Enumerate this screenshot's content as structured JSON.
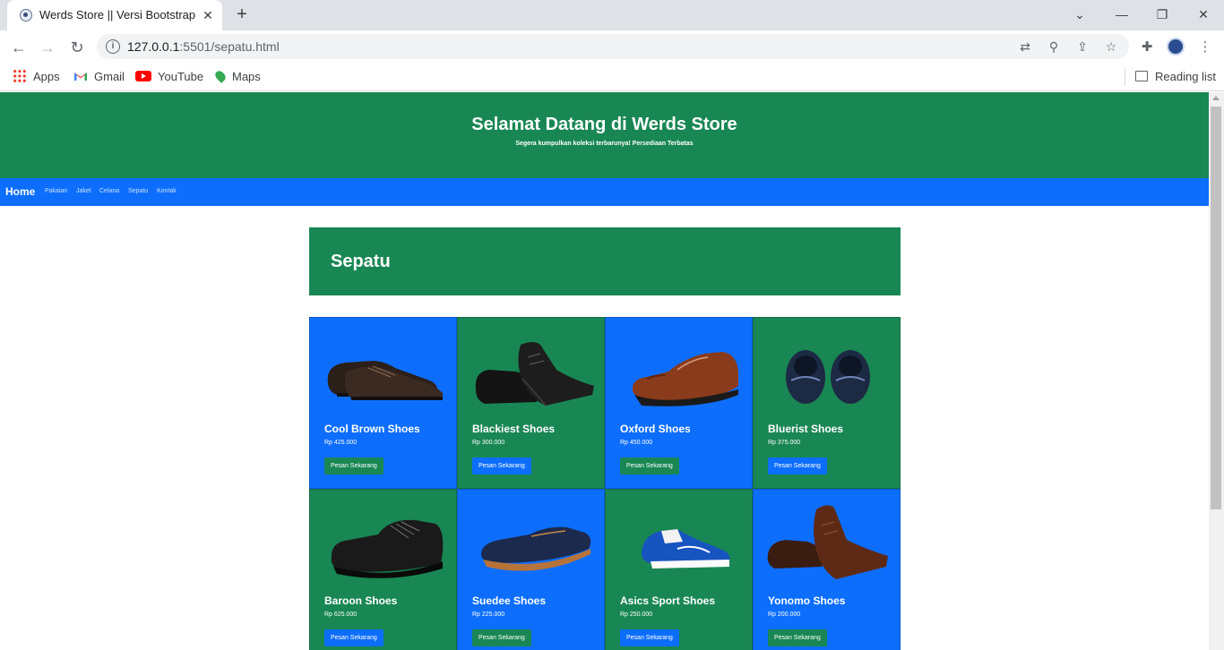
{
  "browser": {
    "tab_title": "Werds Store || Versi Bootstrap",
    "url_host": "127.0.0.1",
    "url_rest": ":5501/sepatu.html",
    "bookmarks": [
      {
        "label": "Apps",
        "icon": "apps-grid-icon"
      },
      {
        "label": "Gmail",
        "icon": "gmail-icon"
      },
      {
        "label": "YouTube",
        "icon": "youtube-icon"
      },
      {
        "label": "Maps",
        "icon": "maps-icon"
      }
    ],
    "reading_list": "Reading list"
  },
  "hero": {
    "title": "Selamat Datang di Werds Store",
    "subtitle": "Segera kumpulkan koleksi terbarunya! Persediaan Terbatas"
  },
  "nav": {
    "brand": "Home",
    "links": [
      "Pakaian",
      "Jaket",
      "Celana",
      "Sepatu",
      "Kontak"
    ]
  },
  "section": {
    "title": "Sepatu"
  },
  "products": [
    {
      "name": "Cool Brown Shoes",
      "price": "Rp 425.000",
      "button": "Pesan Sekarang",
      "bg": "#0d6efd"
    },
    {
      "name": "Blackiest Shoes",
      "price": "Rp 300.000",
      "button": "Pesan Sekarang",
      "bg": "#198754"
    },
    {
      "name": "Oxford Shoes",
      "price": "Rp 450.000",
      "button": "Pesan Sekarang",
      "bg": "#0d6efd"
    },
    {
      "name": "Bluerist Shoes",
      "price": "Rp 375.000",
      "button": "Pesan Sekarang",
      "bg": "#198754"
    },
    {
      "name": "Baroon Shoes",
      "price": "Rp 625.000",
      "button": "Pesan Sekarang",
      "bg": "#198754"
    },
    {
      "name": "Suedee Shoes",
      "price": "Rp 225.000",
      "button": "Pesan Sekarang",
      "bg": "#0d6efd"
    },
    {
      "name": "Asics Sport Shoes",
      "price": "Rp 250.000",
      "button": "Pesan Sekarang",
      "bg": "#198754"
    },
    {
      "name": "Yonomo Shoes",
      "price": "Rp 200.000",
      "button": "Pesan Sekarang",
      "bg": "#0d6efd"
    }
  ],
  "colors": {
    "primary": "#0d6efd",
    "success": "#198754"
  }
}
